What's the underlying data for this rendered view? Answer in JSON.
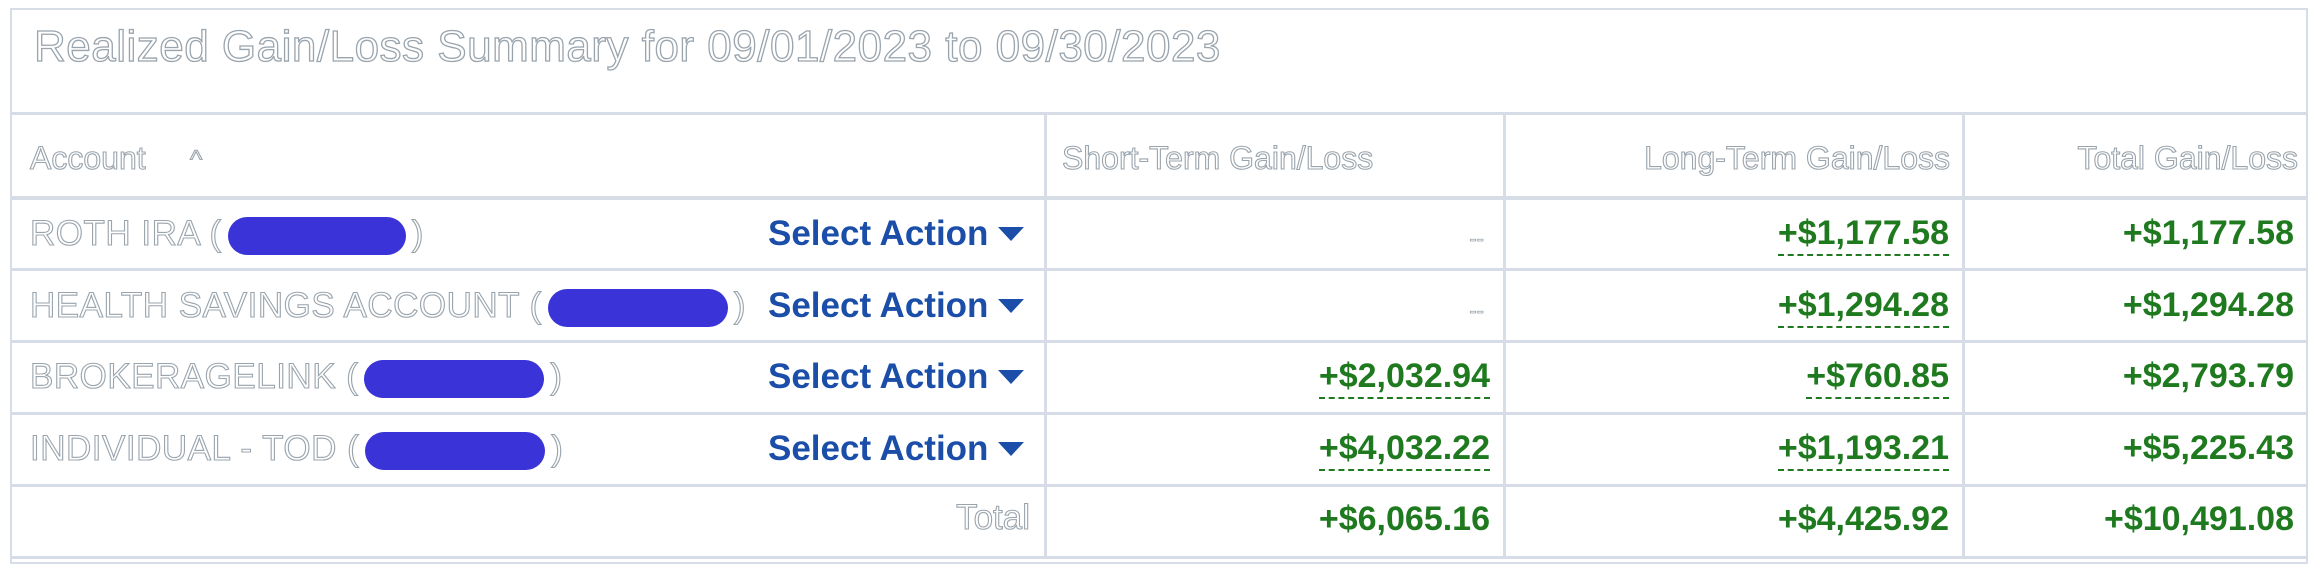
{
  "title": "Realized Gain/Loss Summary for 09/01/2023 to 09/30/2023",
  "headers": {
    "account": "Account",
    "short_term": "Short-Term Gain/Loss",
    "long_term": "Long-Term Gain/Loss",
    "total": "Total Gain/Loss"
  },
  "sort_icon": "chevron-up-icon",
  "rows": [
    {
      "account": "ROTH IRA (",
      "suffix": ")",
      "action": "Select Action",
      "short_term": "--",
      "long_term": "+$1,177.58",
      "total": "+$1,177.58"
    },
    {
      "account": "HEALTH SAVINGS ACCOUNT (",
      "suffix": ")",
      "action": "Select Action",
      "short_term": "--",
      "long_term": "+$1,294.28",
      "total": "+$1,294.28"
    },
    {
      "account": "BROKERAGELINK (",
      "suffix": ")",
      "action": "Select Action",
      "short_term": "+$2,032.94",
      "long_term": "+$760.85",
      "total": "+$2,793.79"
    },
    {
      "account": "INDIVIDUAL - TOD (",
      "suffix": ")",
      "action": "Select Action",
      "short_term": "+$4,032.22",
      "long_term": "+$1,193.21",
      "total": "+$5,225.43"
    }
  ],
  "totals": {
    "label": "Total",
    "short_term": "+$6,065.16",
    "long_term": "+$4,425.92",
    "total": "+$10,491.08"
  },
  "colors": {
    "gain": "#1f7a1f",
    "action": "#1a4ea8",
    "redaction": "#3a34d8",
    "grid": "#d6dde6"
  }
}
